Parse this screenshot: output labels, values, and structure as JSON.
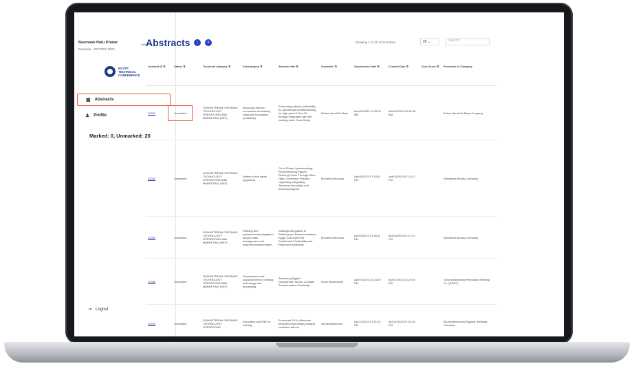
{
  "sidebar": {
    "user_name": "Basmaan Hatu Khatar",
    "user_sub": "Reviewer · EGYPES 2023",
    "switch_label": "switch",
    "logo_text": "EGYPT TECHNICAL CONFERENCE",
    "nav": [
      {
        "label": "Abstracts",
        "icon": "calendar-icon"
      },
      {
        "label": "Profile",
        "icon": "person-icon"
      }
    ],
    "marked_summary": "Marked: 0, Unmarked: 20",
    "logout_label": "Logout"
  },
  "main": {
    "title": "Abstracts",
    "showing": "Showing 1 to 20 of 20 entries",
    "per_page": "20",
    "search_placeholder": "Search:"
  },
  "table": {
    "headers": [
      "Abstract ID",
      "Status",
      "Technical category",
      "Subcategory",
      "Abstract title",
      "Submitter",
      "Submission Date",
      "Created Date",
      "Your Score",
      "Presenter & Company"
    ],
    "rows": [
      {
        "id": "22001",
        "status": "Unmarked",
        "category": "DOWNSTREAM: REFINING TECHNOLOGY OPERATIONS AND MARKETING (REF)",
        "subcategory": "Improving refinery economics decreasing costs and increasing profitability",
        "title": "Enhancing refinery profitability by operational debottlenecking for high yield of Gas Oil through integration with the existing units: Case Study",
        "submitter": "Eslam Hamdi Al-Masri",
        "submission": "Mar/29/2023 11:34:32 AM",
        "created": "Mar/29/2023 09:33:45 AM",
        "score": "",
        "presenter": "Eslam Hamdi Al-Masri Company"
      },
      {
        "id": "22002",
        "status": "Unmarked",
        "category": "DOWNSTREAM: REFINING TECHNOLOGY OPERATIONS AND MARKETING (REF)",
        "subcategory": "Bottom of the barrel upgrading",
        "title": "Go-in Phase Hydrocracking: Revolutionizing Egypt's Refining Future Through Ultra-High Conversion Residue Upgrading Integrating Technical Innovation and technical support",
        "submitter": "Mohamed Moussa",
        "submission": "Apr/03/2023 07:15:32 PM",
        "created": "Apr/03/2023 07:15:22 PM",
        "score": "",
        "presenter": "Mohamed Moussa company"
      },
      {
        "id": "22003",
        "status": "Unmarked",
        "category": "DOWNSTREAM: REFINING TECHNOLOGY OPERATIONS AND MARKETING (REF)",
        "subcategory": "Refining and petrochemical integration supply chain management and business transformation",
        "title": "Strategic Integration of Refining and Petrochemicals in Egypt: A Blueprint for Sustainable Profitability and Regional Leadership",
        "submitter": "Mohamed Moussa",
        "submission": "Apr/03/2023 07:48:11 PM",
        "created": "Apr/03/2023 07:47:41 PM",
        "score": "",
        "presenter": "Mohamed Moussa company"
      },
      {
        "id": "22008",
        "status": "Unmarked",
        "category": "DOWNSTREAM: REFINING TECHNOLOGY OPERATIONS AND MARKETING (REF)",
        "subcategory": "Development and advancements in refining technology and processing",
        "title": "Advancing Egypt's Downstream Sector: A Digital Transformation Roadmap",
        "submitter": "Omar Abdelhamid",
        "submission": "Apr/07/2023 12:24:49 PM",
        "created": "Apr/07/2023 12:24:04 PM",
        "score": "",
        "presenter": "Omar Abdelhamid Petroleum Refining Co. (EGPC)"
      },
      {
        "id": "22010",
        "status": "Unmarked",
        "category": "DOWNSTREAM: REFINING TECHNOLOGY OPERATIONS",
        "subcategory": "Innovation and R&D in refining",
        "title": "Enhanced CoTo Ultra-lean ethylated ultra-steady catalyst reduction with for",
        "submitter": "Aly Abdelmeneim",
        "submission": "Apr/12/2023 07:41:22 PM",
        "created": "Apr/12/2023 07:41:16 PM",
        "score": "",
        "presenter": "Aly Abdelmeneim Egyptian Refining Company"
      }
    ]
  }
}
